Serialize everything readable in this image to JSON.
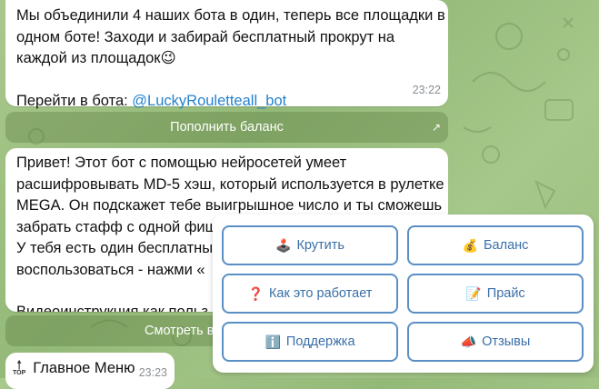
{
  "msg1": {
    "line1": "Мы объединили 4 наших бота в один, теперь все площадки в",
    "line2": "одном боте! Заходи и забирай бесплатный прокрут на",
    "line3": "каждой из площадок😉",
    "goto_label": "Перейти в бота: ",
    "bot_link": "@LuckyRouletteall_bot",
    "time": "23:22"
  },
  "btn_topup": {
    "label": "Пополнить баланс",
    "arrow": "↗"
  },
  "msg2": {
    "line1": "Привет! Этот бот с помощью нейросетей умеет",
    "line2": "расшифровывать MD-5 хэш, который используется в рулетке",
    "line3": "MEGA. Он подскажет тебе выигрышное число и ты сможешь",
    "line4": "забрать стафф с одной фиш",
    "line5": "У тебя есть один бесплатны",
    "line6": "воспользоваться - нажми «",
    "line7": "Видеоинструкция как польз"
  },
  "btn_watch": {
    "label": "Смотреть в"
  },
  "msg3": {
    "top_label": "TOP",
    "text": "Главное Меню",
    "time": "23:23"
  },
  "keyboard": {
    "spin": {
      "icon": "🕹️",
      "label": "Крутить"
    },
    "balance": {
      "icon": "💰",
      "label": "Баланс"
    },
    "how": {
      "icon": "❓",
      "label": "Как это работает"
    },
    "price": {
      "icon": "📝",
      "label": "Прайс"
    },
    "support": {
      "icon": "ℹ️",
      "label": "Поддержка"
    },
    "reviews": {
      "icon": "📣",
      "label": "Отзывы"
    }
  },
  "colors": {
    "accent": "#5a8fc5",
    "link": "#2481cc",
    "bg": "#9bbf80"
  }
}
